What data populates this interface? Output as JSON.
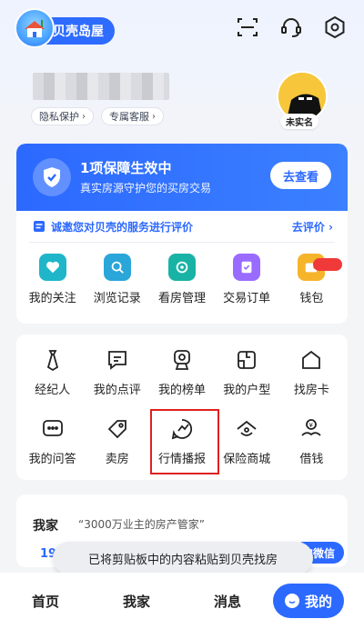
{
  "header": {
    "brand": "贝壳岛屋",
    "icons": [
      "scan-icon",
      "headset-icon",
      "settings-icon"
    ]
  },
  "profile": {
    "tags": [
      "隐私保护",
      "专属客服"
    ],
    "avatar_badge": "未实名"
  },
  "guarantee": {
    "title": "1项保障生效中",
    "subtitle": "真实房源守护您的买房交易",
    "button": "去查看"
  },
  "review": {
    "text": "诚邀您对贝壳的服务进行评价",
    "action": "去评价"
  },
  "quick_actions": [
    {
      "label": "我的关注",
      "icon": "heart-icon",
      "color": "#1fb6c9"
    },
    {
      "label": "浏览记录",
      "icon": "history-icon",
      "color": "#2aa6d9"
    },
    {
      "label": "看房管理",
      "icon": "house-view-icon",
      "color": "#19b3a6"
    },
    {
      "label": "交易订单",
      "icon": "order-icon",
      "color": "#9a6bff"
    },
    {
      "label": "钱包",
      "icon": "wallet-icon",
      "color": "#f6b42b"
    }
  ],
  "services": [
    {
      "label": "经纪人",
      "icon": "agent-icon"
    },
    {
      "label": "我的点评",
      "icon": "comment-icon"
    },
    {
      "label": "我的榜单",
      "icon": "rank-icon"
    },
    {
      "label": "我的户型",
      "icon": "floorplan-icon"
    },
    {
      "label": "找房卡",
      "icon": "house-card-icon"
    },
    {
      "label": "我的问答",
      "icon": "qa-icon"
    },
    {
      "label": "卖房",
      "icon": "sell-tag-icon"
    },
    {
      "label": "行情播报",
      "icon": "market-report-icon"
    },
    {
      "label": "保险商城",
      "icon": "insurance-icon"
    },
    {
      "label": "借钱",
      "icon": "loan-icon"
    }
  ],
  "home": {
    "title": "我家",
    "slogan": "“3000万业主的房产管家”",
    "number": "19",
    "wechat": "加微信"
  },
  "toast": "已将剪贴板中的内容粘贴到贝壳找房",
  "tabs": [
    "首页",
    "我家",
    "消息"
  ],
  "active_tab": "我的",
  "colors": {
    "primary": "#2c69ff",
    "badge": "#f03a3a"
  }
}
